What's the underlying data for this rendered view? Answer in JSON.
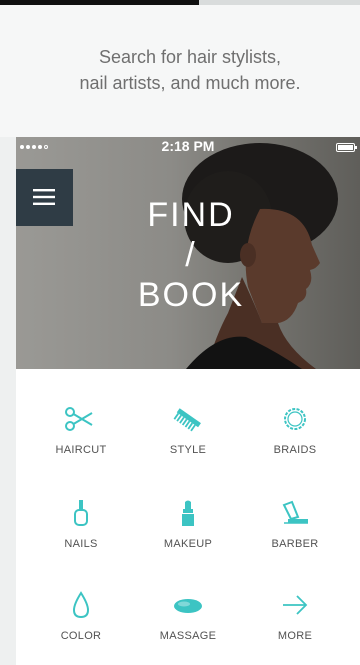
{
  "promo": {
    "tagline_line1": "Search for hair stylists,",
    "tagline_line2": "nail artists, and much more."
  },
  "status_bar": {
    "time": "2:18 PM"
  },
  "hero": {
    "title_line1": "FIND",
    "title_line2": "/",
    "title_line3": "BOOK"
  },
  "categories": [
    {
      "label": "HAIRCUT",
      "icon": "scissors-icon"
    },
    {
      "label": "STYLE",
      "icon": "comb-icon"
    },
    {
      "label": "BRAIDS",
      "icon": "braids-icon"
    },
    {
      "label": "NAILS",
      "icon": "nail-polish-icon"
    },
    {
      "label": "MAKEUP",
      "icon": "lipstick-icon"
    },
    {
      "label": "BARBER",
      "icon": "razor-icon"
    },
    {
      "label": "COLOR",
      "icon": "drop-icon"
    },
    {
      "label": "MASSAGE",
      "icon": "massage-stone-icon"
    },
    {
      "label": "MORE",
      "icon": "arrow-right-icon"
    }
  ],
  "colors": {
    "accent": "#3cc4c3",
    "menu_bg": "#2f3c45",
    "label": "#525252",
    "tagline": "#6f6f6f"
  }
}
